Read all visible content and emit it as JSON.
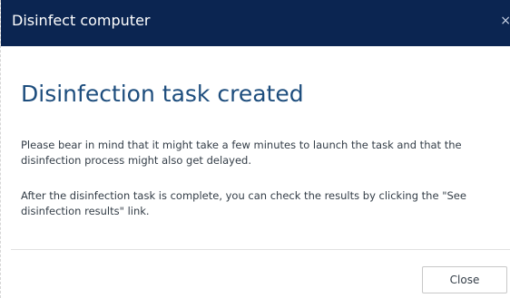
{
  "dialog": {
    "title": "Disinfect computer",
    "close_glyph": "×",
    "heading": "Disinfection task created",
    "paragraph_1": "Please bear in mind that it might take a few minutes to launch the task and that the disinfection process might also get delayed.",
    "paragraph_2": "After the disinfection task is complete, you can check the results by clicking the \"See disinfection results\" link.",
    "close_button_label": "Close"
  },
  "colors": {
    "titlebar_bg": "#0b2551",
    "heading": "#1d4d7d",
    "text": "#333d47"
  }
}
